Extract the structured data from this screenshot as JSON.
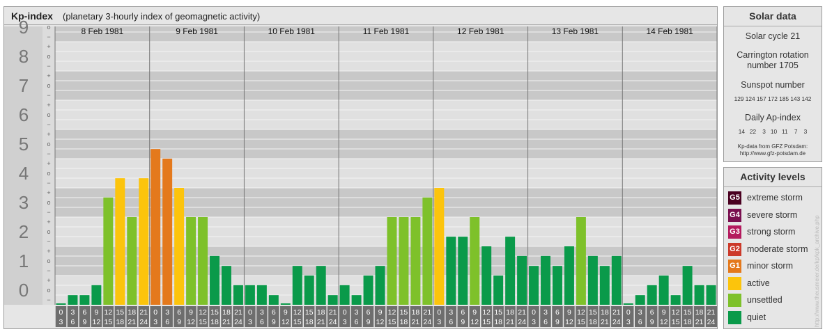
{
  "header": {
    "title": "Kp-index",
    "subtitle": "(planetary 3-hourly index of geomagnetic activity)"
  },
  "chart_data": {
    "type": "bar",
    "title": "Kp-index",
    "subtitle": "(planetary 3-hourly index of geomagnetic activity)",
    "ylim": [
      0,
      9
    ],
    "y_ticks": [
      "0",
      "1",
      "2",
      "3",
      "4",
      "5",
      "6",
      "7",
      "8",
      "9"
    ],
    "y_subticks": [
      "+",
      "o",
      "−"
    ],
    "days": [
      "8 Feb 1981",
      "9 Feb 1981",
      "10 Feb 1981",
      "11 Feb 1981",
      "12 Feb 1981",
      "13 Feb 1981",
      "14 Feb 1981"
    ],
    "interval_top": [
      "0",
      "3",
      "6",
      "9",
      "12",
      "15",
      "18",
      "21"
    ],
    "interval_bottom": [
      "3",
      "6",
      "9",
      "12",
      "15",
      "18",
      "21",
      "24"
    ],
    "values": [
      [
        0.0,
        0.33,
        0.33,
        0.67,
        3.67,
        4.33,
        3.0,
        4.33
      ],
      [
        5.33,
        5.0,
        4.0,
        3.0,
        3.0,
        1.67,
        1.33,
        0.67
      ],
      [
        0.67,
        0.67,
        0.33,
        0.0,
        1.33,
        1.0,
        1.33,
        0.33
      ],
      [
        0.67,
        0.33,
        1.0,
        1.33,
        3.0,
        3.0,
        3.0,
        3.67
      ],
      [
        4.0,
        2.33,
        2.33,
        3.0,
        2.0,
        1.0,
        2.33,
        1.67
      ],
      [
        1.33,
        1.67,
        1.33,
        2.0,
        3.0,
        1.67,
        1.33,
        1.67
      ],
      [
        0.0,
        0.33,
        0.67,
        1.0,
        0.33,
        1.33,
        0.67,
        0.67
      ]
    ]
  },
  "colors": {
    "quiet": "#0a9a4a",
    "unsettled": "#7ec12a",
    "active": "#fcc40c",
    "minor": "#e4791c",
    "moderate": "#cc3a2a",
    "strong": "#b41a5e",
    "severe": "#7a1050",
    "extreme": "#4a0020"
  },
  "solar": {
    "title": "Solar data",
    "cycle": "Solar cycle 21",
    "carrington_line1": "Carrington rotation",
    "carrington_line2": "number 1705",
    "sunspot_label": "Sunspot number",
    "sunspot_values": "129 124 157 172 185 143 142",
    "ap_label": "Daily Ap-index",
    "ap_values": "14   22    3   10   11    7    3",
    "source_line1": "Kp-data from GFZ Potsdam:",
    "source_line2": "http://www.gfz-potsdam.de"
  },
  "activity": {
    "title": "Activity levels",
    "items": [
      {
        "code": "G5",
        "label": "extreme storm",
        "color": "#4a0020"
      },
      {
        "code": "G4",
        "label": "severe storm",
        "color": "#7a1050"
      },
      {
        "code": "G3",
        "label": "strong storm",
        "color": "#b41a5e"
      },
      {
        "code": "G2",
        "label": "moderate storm",
        "color": "#cc3a2a"
      },
      {
        "code": "G1",
        "label": "minor storm",
        "color": "#e4791c"
      },
      {
        "code": "",
        "label": "active",
        "color": "#fcc40c"
      },
      {
        "code": "",
        "label": "unsettled",
        "color": "#7ec12a"
      },
      {
        "code": "",
        "label": "quiet",
        "color": "#0a9a4a"
      }
    ]
  },
  "credit": "http://www.theusmeier.de/kp/kpk_archive.php"
}
